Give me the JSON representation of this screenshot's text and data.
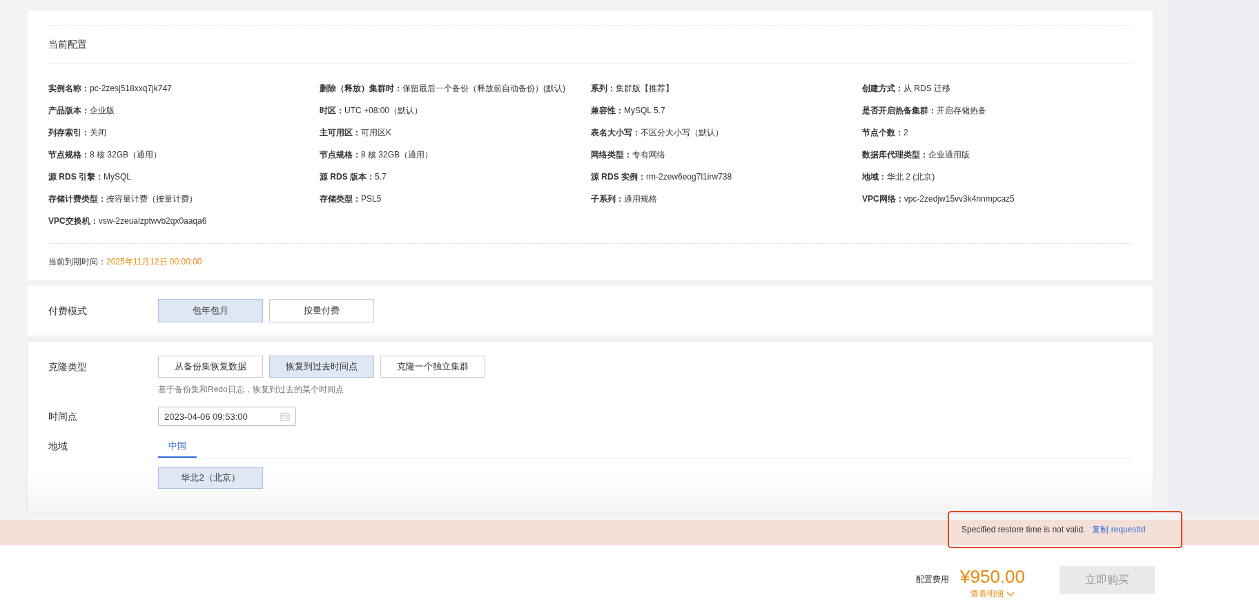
{
  "current_config": {
    "title": "当前配置",
    "fields": [
      {
        "label": "实例名称：",
        "value": "pc-2zesj518xxq7jk747"
      },
      {
        "label": "删除（释放）集群时：",
        "value": "保留最后一个备份（释放前自动备份）(默认)"
      },
      {
        "label": "系列：",
        "value": "集群版【推荐】"
      },
      {
        "label": "创建方式：",
        "value": "从 RDS 迁移"
      },
      {
        "label": "产品版本：",
        "value": "企业版"
      },
      {
        "label": "时区：",
        "value": "UTC +08:00（默认）"
      },
      {
        "label": "兼容性：",
        "value": "MySQL 5.7"
      },
      {
        "label": "是否开启热备集群：",
        "value": "开启存储热备"
      },
      {
        "label": "列存索引：",
        "value": "关闭"
      },
      {
        "label": "主可用区：",
        "value": "可用区K"
      },
      {
        "label": "表名大小写：",
        "value": "不区分大小写（默认）"
      },
      {
        "label": "节点个数：",
        "value": "2"
      },
      {
        "label": "节点规格：",
        "value": "8 核 32GB（通用）"
      },
      {
        "label": "节点规格：",
        "value": "8 核 32GB（通用）"
      },
      {
        "label": "网络类型：",
        "value": "专有网络"
      },
      {
        "label": "数据库代理类型：",
        "value": "企业通用版"
      },
      {
        "label": "源 RDS 引擎：",
        "value": "MySQL"
      },
      {
        "label": "源 RDS 版本：",
        "value": "5.7"
      },
      {
        "label": "源 RDS 实例：",
        "value": "rm-2zew6eog7l1irw738"
      },
      {
        "label": "地域：",
        "value": "华北 2 (北京)"
      },
      {
        "label": "存储计费类型：",
        "value": "按容量计费（按量计费）"
      },
      {
        "label": "存储类型：",
        "value": "PSL5"
      },
      {
        "label": "子系列：",
        "value": "通用规格"
      },
      {
        "label": "VPC网络：",
        "value": "vpc-2zedjw15vv3k4nnmpcaz5"
      },
      {
        "label": "VPC交换机：",
        "value": "vsw-2zeualzptwvb2qx0aaqa6"
      }
    ],
    "expiry": {
      "label": "当前到期时间：",
      "value": "2025年11月12日 00:00:00"
    }
  },
  "payment": {
    "label": "付费模式",
    "options": [
      {
        "label": "包年包月",
        "selected": true
      },
      {
        "label": "按量付费",
        "selected": false
      }
    ]
  },
  "clone": {
    "type_label": "克隆类型",
    "options": [
      {
        "label": "从备份集恢复数据",
        "selected": false
      },
      {
        "label": "恢复到过去时间点",
        "selected": true
      },
      {
        "label": "克隆一个独立集群",
        "selected": false
      }
    ],
    "hint": "基于备份集和Redo日志，恢复到过去的某个时间点",
    "time_label": "时间点",
    "time_value": "2023-04-06 09:53:00",
    "region_label": "地域",
    "region_tabs": [
      {
        "label": "中国",
        "selected": true
      }
    ],
    "regions": [
      {
        "label": "华北2（北京）",
        "selected": true
      }
    ]
  },
  "error": {
    "message": "Specified restore time is not valid.",
    "link": "复制 requestId"
  },
  "footer": {
    "fee_label": "配置费用",
    "price": "¥950.00",
    "details": "查看明细",
    "buy_button": {
      "label": "立即购买",
      "disabled": true
    }
  }
}
